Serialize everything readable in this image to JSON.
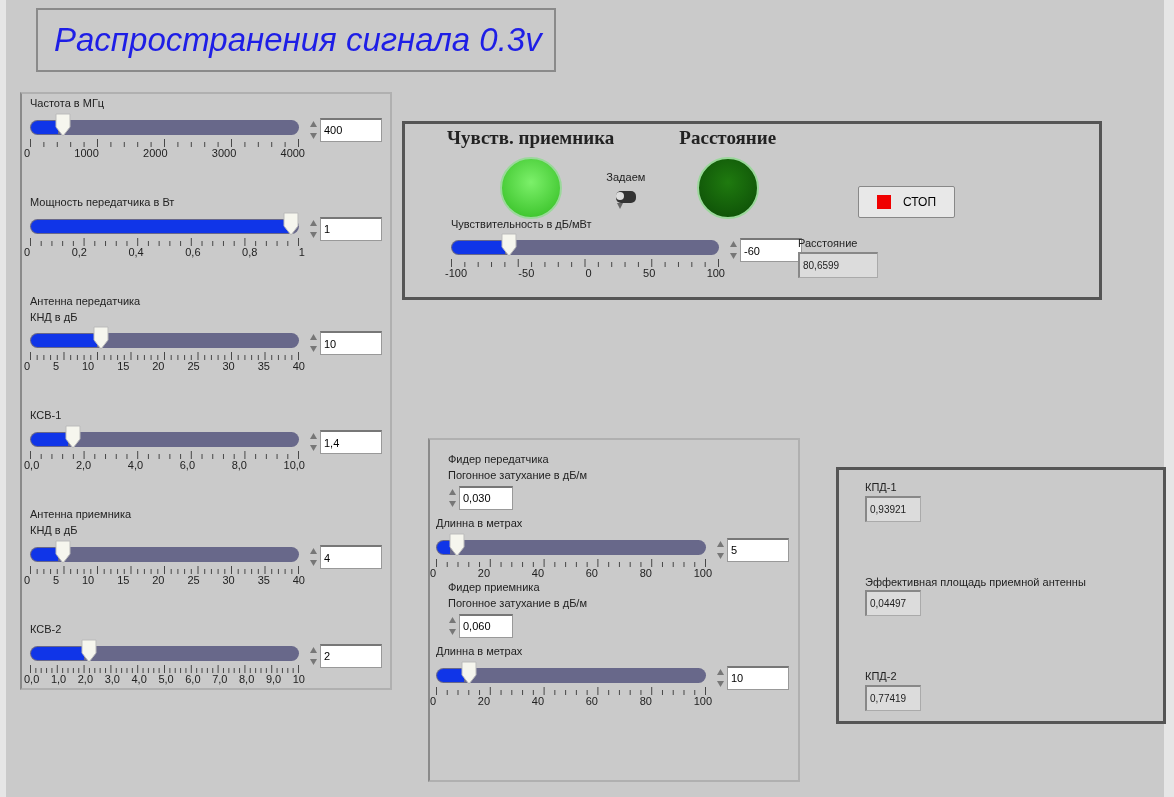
{
  "title": "Распространения сигнала 0.3v",
  "left_panel": {
    "sliders": [
      {
        "labels": [
          "Частота в МГц"
        ],
        "level": 0.1,
        "ticks": [
          "0",
          "1000",
          "2000",
          "3000",
          "4000"
        ],
        "value": "400"
      },
      {
        "labels": [
          "Мощность передатчика в Вт"
        ],
        "level": 1,
        "ticks": [
          "0",
          "0,2",
          "0,4",
          "0,6",
          "0,8",
          "1"
        ],
        "value": "1"
      },
      {
        "labels": [
          "Антенна передатчика",
          "КНД в дБ"
        ],
        "level": 0.25,
        "ticks": [
          "0",
          "5",
          "10",
          "15",
          "20",
          "25",
          "30",
          "35",
          "40"
        ],
        "value": "10"
      },
      {
        "labels": [
          "КСВ-1"
        ],
        "level": 0.14,
        "ticks": [
          "0,0",
          "2,0",
          "4,0",
          "6,0",
          "8,0",
          "10,0"
        ],
        "value": "1,4"
      },
      {
        "labels": [
          "Антенна приемника",
          "КНД в дБ"
        ],
        "level": 0.1,
        "ticks": [
          "0",
          "5",
          "10",
          "15",
          "20",
          "25",
          "30",
          "35",
          "40"
        ],
        "value": "4"
      },
      {
        "labels": [
          "КСВ-2"
        ],
        "level": 0.2,
        "ticks": [
          "0,0",
          "1,0",
          "2,0",
          "3,0",
          "4,0",
          "5,0",
          "6,0",
          "7,0",
          "8,0",
          "9,0",
          "10"
        ],
        "value": "2"
      }
    ]
  },
  "receiver_panel": {
    "leds": [
      {
        "label": "Чувств. приемника",
        "on": true
      },
      {
        "label": "Расстояние",
        "on": false
      }
    ],
    "switch_label": "Задаем",
    "switch_on": false,
    "slider": {
      "labels": [
        "Чувствительность в дБ/мВт"
      ],
      "level": 0.2,
      "ticks": [
        "-100",
        "-50",
        "0",
        "50",
        "100"
      ],
      "value": "-60"
    },
    "stop_button": {
      "label": "СТОП"
    },
    "indicator": {
      "label": "Расстояние",
      "value": "80,6599"
    }
  },
  "feeder_panel": {
    "groups": [
      {
        "labels": [
          "Фидер передатчика",
          "Погонное затухание в дБ/м"
        ],
        "attenuation": "0,030",
        "slider": {
          "labels": [
            "Длинна в метрах"
          ],
          "level": 0.05,
          "ticks": [
            "0",
            "20",
            "40",
            "60",
            "80",
            "100"
          ],
          "value": "5"
        }
      },
      {
        "labels": [
          "Фидер приемника",
          "Погонное затухание в дБ/м"
        ],
        "attenuation": "0,060",
        "slider": {
          "labels": [
            "Длинна в метрах"
          ],
          "level": 0.1,
          "ticks": [
            "0",
            "20",
            "40",
            "60",
            "80",
            "100"
          ],
          "value": "10"
        }
      }
    ]
  },
  "efficiency_panel": {
    "indicators": [
      {
        "label": "КПД-1",
        "value": "0,93921"
      },
      {
        "label": "Эффективная площадь приемной антенны",
        "value": "0,04497"
      },
      {
        "label": "КПД-2",
        "value": "0,77419"
      }
    ]
  }
}
